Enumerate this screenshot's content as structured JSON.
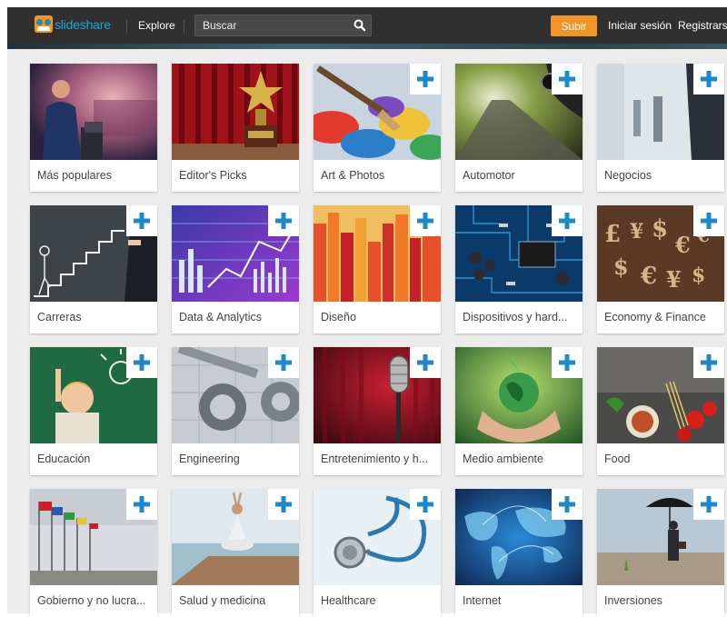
{
  "header": {
    "logo_text": "slideshare",
    "explore_label": "Explore",
    "search": {
      "placeholder": "Buscar"
    },
    "upload_label": "Subir",
    "login_label": "Iniciar sesión",
    "register_label": "Registrarse"
  },
  "colors": {
    "header_bg": "#303030",
    "accent_orange": "#f19626",
    "plus_blue": "#1e88c9",
    "logo_blue": "#1ea4d6"
  },
  "categories": [
    {
      "label": "Más populares",
      "followable": false,
      "icon": "plus-icon"
    },
    {
      "label": "Editor's Picks",
      "followable": false,
      "icon": "plus-icon"
    },
    {
      "label": "Art & Photos",
      "followable": true,
      "icon": "plus-icon"
    },
    {
      "label": "Automotor",
      "followable": true,
      "icon": "plus-icon"
    },
    {
      "label": "Negocios",
      "followable": true,
      "icon": "plus-icon"
    },
    {
      "label": "Carreras",
      "followable": true,
      "icon": "plus-icon"
    },
    {
      "label": "Data & Analytics",
      "followable": true,
      "icon": "plus-icon"
    },
    {
      "label": "Diseño",
      "followable": true,
      "icon": "plus-icon"
    },
    {
      "label": "Dispositivos y hard...",
      "followable": true,
      "icon": "plus-icon"
    },
    {
      "label": "Economy & Finance",
      "followable": true,
      "icon": "plus-icon"
    },
    {
      "label": "Educación",
      "followable": true,
      "icon": "plus-icon"
    },
    {
      "label": "Engineering",
      "followable": true,
      "icon": "plus-icon"
    },
    {
      "label": "Entretenimiento y h...",
      "followable": true,
      "icon": "plus-icon"
    },
    {
      "label": "Medio ambiente",
      "followable": true,
      "icon": "plus-icon"
    },
    {
      "label": "Food",
      "followable": true,
      "icon": "plus-icon"
    },
    {
      "label": "Gobierno y no lucra...",
      "followable": true,
      "icon": "plus-icon"
    },
    {
      "label": "Salud y medicina",
      "followable": true,
      "icon": "plus-icon"
    },
    {
      "label": "Healthcare",
      "followable": true,
      "icon": "plus-icon"
    },
    {
      "label": "Internet",
      "followable": true,
      "icon": "plus-icon"
    },
    {
      "label": "Inversiones",
      "followable": true,
      "icon": "plus-icon"
    }
  ]
}
